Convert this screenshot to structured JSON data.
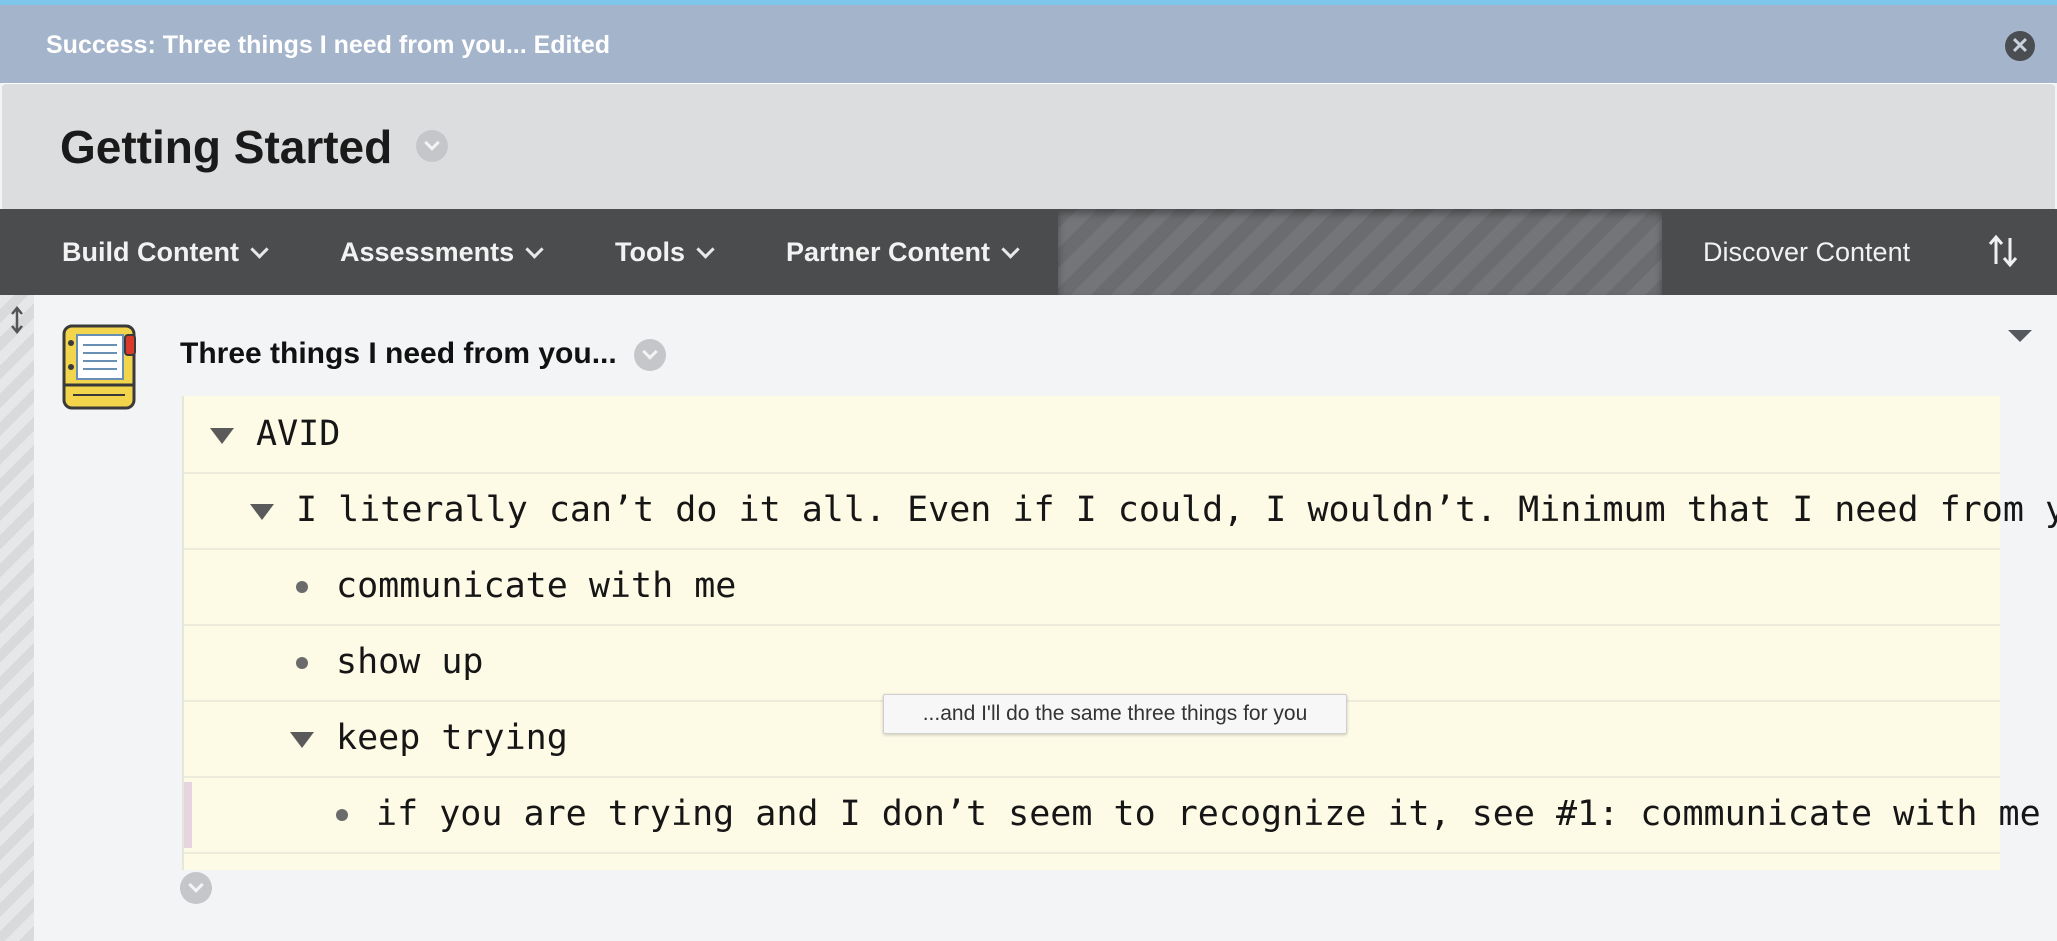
{
  "notification": {
    "message": "Success: Three things I need from you... Edited",
    "close_icon": "close-icon"
  },
  "page": {
    "title": "Getting Started"
  },
  "menu": {
    "items": [
      {
        "label": "Build Content"
      },
      {
        "label": "Assessments"
      },
      {
        "label": "Tools"
      },
      {
        "label": "Partner Content"
      }
    ],
    "discover_label": "Discover Content"
  },
  "content_item": {
    "title": "Three things I need from you...",
    "icon": "notebook-icon",
    "outline": [
      {
        "text": "AVID",
        "marker": "triangle"
      },
      {
        "text": "I literally can’t do it all. Even if I could, I wouldn’t. Minimum that I need from you:",
        "marker": "triangle"
      },
      {
        "text": "communicate with me",
        "marker": "bullet"
      },
      {
        "text": "show up",
        "marker": "bullet"
      },
      {
        "text": "keep trying",
        "marker": "triangle"
      },
      {
        "text": "if you are trying and I don’t seem to recognize it, see #1: communicate with me",
        "marker": "bullet"
      }
    ],
    "tooltip": "...and I'll do the same three things for you"
  },
  "colors": {
    "accent_line": "#7fc6ec",
    "success_bar": "#a4b4cb",
    "menubar": "#4a4c4e",
    "outline_bg": "#fdfae6"
  }
}
